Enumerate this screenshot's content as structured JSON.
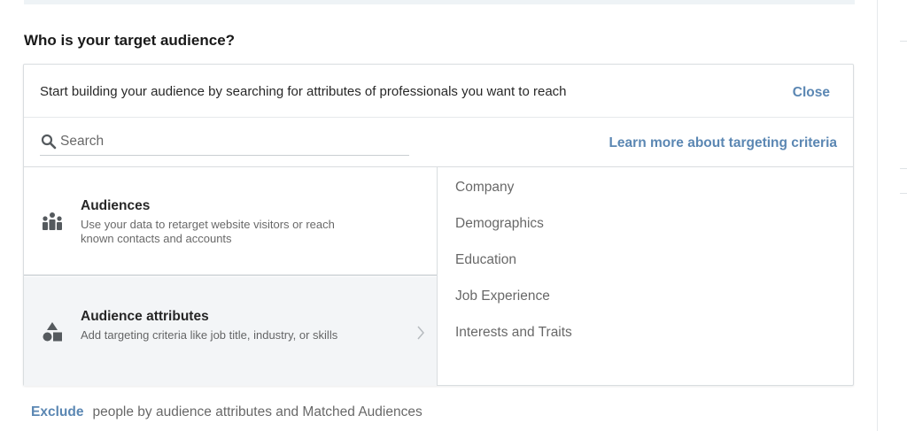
{
  "page": {
    "heading": "Who is your target audience?"
  },
  "builder": {
    "intro_text": "Start building your audience by searching for attributes of professionals you want to reach",
    "close_label": "Close",
    "search_placeholder": "Search",
    "search_value": "",
    "learn_more_label": "Learn more about targeting criteria"
  },
  "options": [
    {
      "title": "Audiences",
      "description": "Use your data to retarget website visitors or reach known contacts and accounts",
      "icon": "group-people-icon",
      "selected": false
    },
    {
      "title": "Audience attributes",
      "description": "Add targeting criteria like job title, industry, or skills",
      "icon": "shapes-icon",
      "selected": true
    }
  ],
  "categories": [
    "Company",
    "Demographics",
    "Education",
    "Job Experience",
    "Interests and Traits"
  ],
  "exclude": {
    "link_label": "Exclude",
    "text": "people by audience attributes and Matched Audiences"
  },
  "colors": {
    "accent": "#5b87b3",
    "selected_bg": "#f3f5f7",
    "border": "#d9dde0",
    "icon": "#555a5e"
  }
}
